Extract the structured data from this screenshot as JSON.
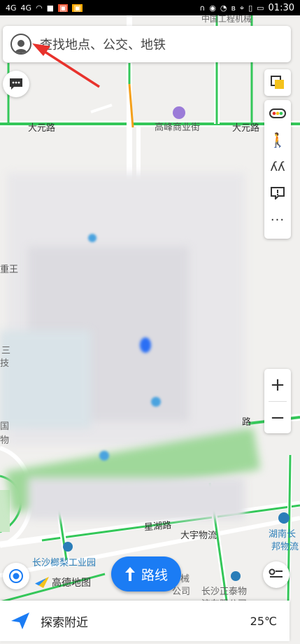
{
  "status_bar": {
    "signal_left": "4G",
    "signal_right": "4G",
    "time": "01:30"
  },
  "search": {
    "placeholder": "查找地点、公交、地铁"
  },
  "map": {
    "labels": {
      "road_top": "中国工程机械",
      "road_left": "大元路",
      "poi_center": "高峰商业街",
      "road_right": "大元路",
      "park": "长沙榔梨工业园",
      "street": "星湖路",
      "poi_right": "大宇物流",
      "poi_far_right_1": "湖南长",
      "poi_far_right_2": "邦物流",
      "poi_bottom_right_1": "长沙正泰物",
      "poi_bottom_right_2": "流有限公司",
      "poi_bottom_mid_1": "械",
      "poi_bottom_mid_2": "公司",
      "left_label_1": "重王",
      "left_label_2": "三",
      "left_label_3": "技",
      "left_label_4": "国",
      "left_label_5": "物",
      "right_label": "路"
    },
    "brand": "高德地图"
  },
  "buttons": {
    "route_label": "路线",
    "explore_label": "探索附近"
  },
  "weather": {
    "temperature": "25℃"
  },
  "colors": {
    "accent": "#1b7cf4",
    "road_green": "#34c759",
    "road_orange": "#f4a01b",
    "arrow_red": "#e8322c"
  }
}
